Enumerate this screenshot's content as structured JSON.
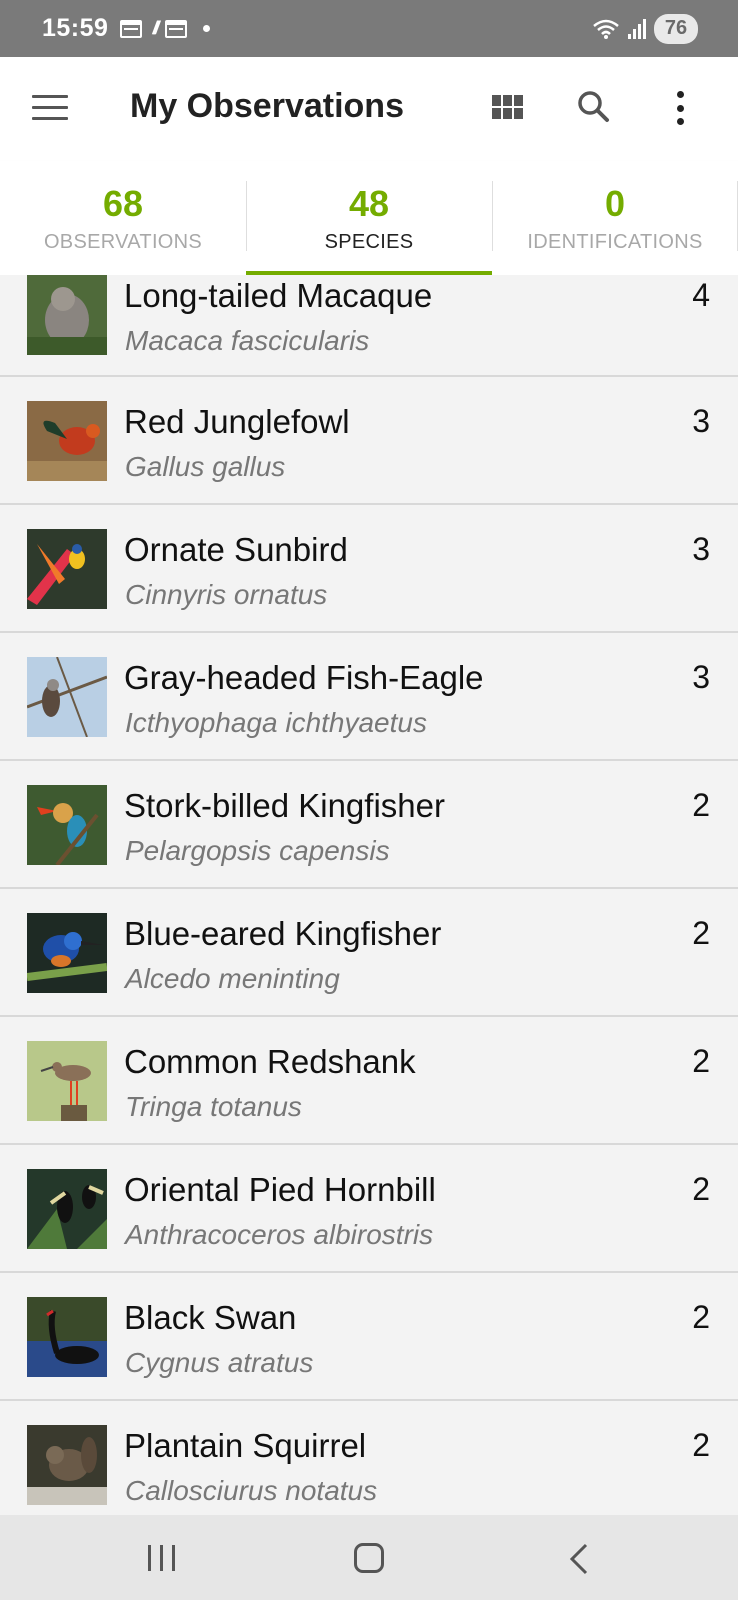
{
  "status_bar": {
    "time": "15:59",
    "battery": "76"
  },
  "app_bar": {
    "title": "My Observations"
  },
  "tabs": [
    {
      "count": "68",
      "label": "OBSERVATIONS",
      "active": false
    },
    {
      "count": "48",
      "label": "SPECIES",
      "active": true
    },
    {
      "count": "0",
      "label": "IDENTIFICATIONS",
      "active": false
    }
  ],
  "species": [
    {
      "common": "Long-tailed Macaque",
      "scientific": "Macaca fascicularis",
      "count": "4",
      "photo": "macaque-photo"
    },
    {
      "common": "Red Junglefowl",
      "scientific": "Gallus gallus",
      "count": "3",
      "photo": "junglefowl-photo"
    },
    {
      "common": "Ornate Sunbird",
      "scientific": "Cinnyris ornatus",
      "count": "3",
      "photo": "sunbird-photo"
    },
    {
      "common": "Gray-headed Fish-Eagle",
      "scientific": "Icthyophaga ichthyaetus",
      "count": "3",
      "photo": "fish-eagle-photo"
    },
    {
      "common": "Stork-billed Kingfisher",
      "scientific": "Pelargopsis capensis",
      "count": "2",
      "photo": "stork-billed-kingfisher-photo"
    },
    {
      "common": "Blue-eared Kingfisher",
      "scientific": "Alcedo meninting",
      "count": "2",
      "photo": "blue-eared-kingfisher-photo"
    },
    {
      "common": "Common Redshank",
      "scientific": "Tringa totanus",
      "count": "2",
      "photo": "redshank-photo"
    },
    {
      "common": "Oriental Pied Hornbill",
      "scientific": "Anthracoceros albirostris",
      "count": "2",
      "photo": "hornbill-photo"
    },
    {
      "common": "Black Swan",
      "scientific": "Cygnus atratus",
      "count": "2",
      "photo": "black-swan-photo"
    },
    {
      "common": "Plantain Squirrel",
      "scientific": "Callosciurus notatus",
      "count": "2",
      "photo": "squirrel-photo"
    }
  ],
  "colors": {
    "accent": "#74ac00",
    "status_bar": "#7a7a7a",
    "list_background": "#f3f3f3"
  }
}
